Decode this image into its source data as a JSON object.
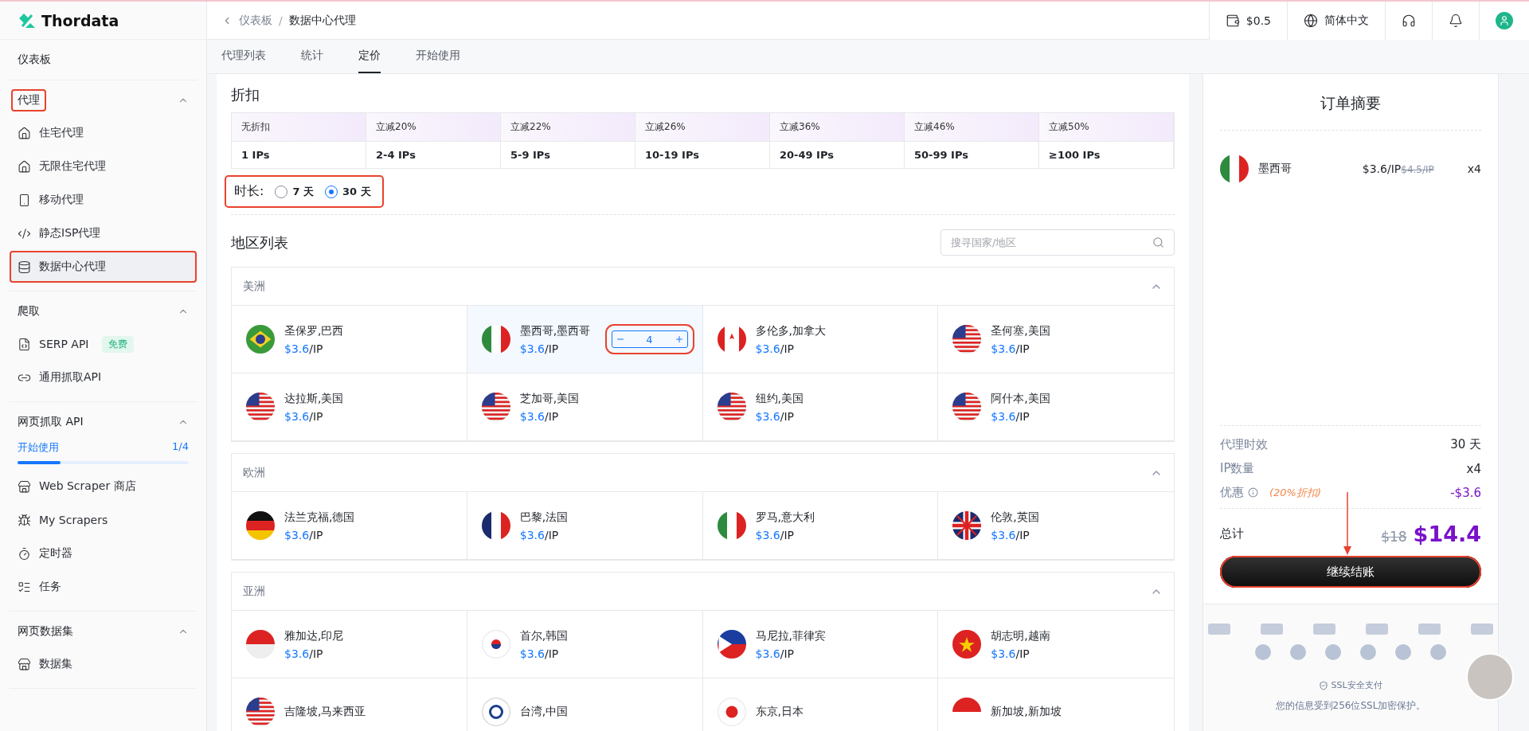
{
  "sidebar": {
    "logo": "Thordata",
    "top_item": "仪表板",
    "sections": [
      {
        "title": "代理",
        "expanded": true,
        "highlighted": true,
        "items": [
          {
            "label": "住宅代理",
            "selected": false,
            "highlighted": false
          },
          {
            "label": "无限住宅代理",
            "selected": false,
            "highlighted": false
          },
          {
            "label": "移动代理",
            "selected": false,
            "highlighted": false
          },
          {
            "label": "静态ISP代理",
            "selected": false,
            "highlighted": false
          },
          {
            "label": "数据中心代理",
            "selected": true,
            "highlighted": true
          }
        ]
      },
      {
        "title": "爬取",
        "expanded": true,
        "highlighted": false,
        "items": [
          {
            "label": "SERP API",
            "badge": "免费",
            "selected": false,
            "highlighted": false
          },
          {
            "label": "通用抓取API",
            "selected": false,
            "highlighted": false
          }
        ]
      },
      {
        "title": "网页抓取 API",
        "expanded": true,
        "highlighted": false,
        "progress": {
          "label": "开始使用",
          "count": "1/4",
          "level": 0.25
        },
        "items": [
          {
            "label": "Web Scraper 商店",
            "selected": false,
            "highlighted": false
          },
          {
            "label": "My Scrapers",
            "selected": false,
            "highlighted": false
          },
          {
            "label": "定时器",
            "selected": false,
            "highlighted": false
          },
          {
            "label": "任务",
            "selected": false,
            "highlighted": false
          }
        ]
      },
      {
        "title": "网页数据集",
        "expanded": true,
        "highlighted": false,
        "items": [
          {
            "label": "数据集",
            "selected": false,
            "highlighted": false
          }
        ]
      }
    ]
  },
  "topbar": {
    "breadcrumb": [
      "仪表板",
      "数据中心代理"
    ],
    "separator": "/",
    "balance": "$0.5",
    "language": "简体中文"
  },
  "tabs": [
    {
      "label": "代理列表",
      "selected": false
    },
    {
      "label": "统计",
      "selected": false
    },
    {
      "label": "定价",
      "selected": true
    },
    {
      "label": "开始使用",
      "selected": false
    }
  ],
  "discount": {
    "title": "折扣",
    "tiers": [
      {
        "label": "无折扣",
        "range": "1 IPs"
      },
      {
        "label": "立减20%",
        "range": "2-4 IPs"
      },
      {
        "label": "立减22%",
        "range": "5-9 IPs"
      },
      {
        "label": "立减26%",
        "range": "10-19 IPs"
      },
      {
        "label": "立减36%",
        "range": "20-49 IPs"
      },
      {
        "label": "立减46%",
        "range": "50-99 IPs"
      },
      {
        "label": "立减50%",
        "range": "≥100 IPs"
      }
    ]
  },
  "duration": {
    "label": "时长:",
    "highlighted": true,
    "options": [
      {
        "label": "7 天",
        "selected": false
      },
      {
        "label": "30 天",
        "selected": true
      }
    ]
  },
  "regions": {
    "title": "地区列表",
    "search": {
      "placeholder": "搜寻国家/地区"
    },
    "groups": [
      {
        "name": "美洲",
        "expanded": true,
        "cities": [
          {
            "name": "圣保罗,巴西",
            "price": "$3.6",
            "unit": "/IP",
            "selected": false
          },
          {
            "name": "墨西哥,墨西哥",
            "price": "$3.6",
            "unit": "/IP",
            "selected": true,
            "quantity": "4",
            "highlighted": true
          },
          {
            "name": "多伦多,加拿大",
            "price": "$3.6",
            "unit": "/IP",
            "selected": false
          },
          {
            "name": "圣何塞,美国",
            "price": "$3.6",
            "unit": "/IP",
            "selected": false
          },
          {
            "name": "达拉斯,美国",
            "price": "$3.6",
            "unit": "/IP",
            "selected": false
          },
          {
            "name": "芝加哥,美国",
            "price": "$3.6",
            "unit": "/IP",
            "selected": false
          },
          {
            "name": "纽约,美国",
            "price": "$3.6",
            "unit": "/IP",
            "selected": false
          },
          {
            "name": "阿什本,美国",
            "price": "$3.6",
            "unit": "/IP",
            "selected": false
          }
        ]
      },
      {
        "name": "欧洲",
        "expanded": true,
        "cities": [
          {
            "name": "法兰克福,德国",
            "price": "$3.6",
            "unit": "/IP",
            "selected": false
          },
          {
            "name": "巴黎,法国",
            "price": "$3.6",
            "unit": "/IP",
            "selected": false
          },
          {
            "name": "罗马,意大利",
            "price": "$3.6",
            "unit": "/IP",
            "selected": false
          },
          {
            "name": "伦敦,英国",
            "price": "$3.6",
            "unit": "/IP",
            "selected": false
          }
        ]
      },
      {
        "name": "亚洲",
        "expanded": true,
        "cities": [
          {
            "name": "雅加达,印尼",
            "price": "$3.6",
            "unit": "/IP",
            "selected": false
          },
          {
            "name": "首尔,韩国",
            "price": "$3.6",
            "unit": "/IP",
            "selected": false
          },
          {
            "name": "马尼拉,菲律宾",
            "price": "$3.6",
            "unit": "/IP",
            "selected": false
          },
          {
            "name": "胡志明,越南",
            "price": "$3.6",
            "unit": "/IP",
            "selected": false
          },
          {
            "name": "吉隆坡,马来西亚",
            "selected": false
          },
          {
            "name": "台湾,中国",
            "selected": false
          },
          {
            "name": "东京,日本",
            "selected": false
          },
          {
            "name": "新加坡,新加坡",
            "selected": false
          }
        ]
      }
    ]
  },
  "summary": {
    "title": "订单摘要",
    "items": [
      {
        "name": "墨西哥",
        "price": "$3.6/IP",
        "old_price": "$4.5/IP",
        "quantity": "x4"
      }
    ],
    "rows": [
      {
        "kind": "plain",
        "label": "代理时效",
        "value": "30 天"
      },
      {
        "kind": "plain",
        "label": "IP数量",
        "value": "x4"
      },
      {
        "kind": "discount",
        "label": "优惠",
        "note": "(20%折扣)",
        "value": "-$3.6"
      }
    ],
    "total": {
      "label": "总计",
      "old": "$18",
      "value": "$14.4"
    },
    "checkout": {
      "label": "继续结账",
      "highlighted": true
    },
    "ssl": "SSL安全支付",
    "security_note": "您的信息受到256位SSL加密保护。"
  }
}
